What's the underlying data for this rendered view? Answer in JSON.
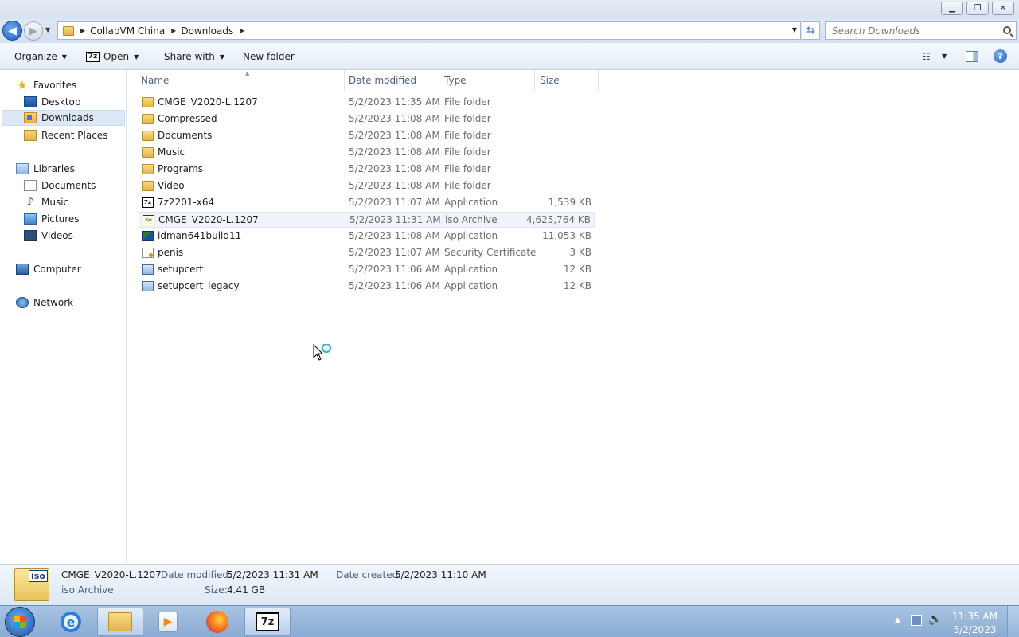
{
  "window": {
    "minimize_icon": "minimize-icon",
    "restore_icon": "restore-icon",
    "close_icon": "close-icon"
  },
  "address": {
    "crumbs": [
      "CollabVM China",
      "Downloads"
    ],
    "search_placeholder": "Search Downloads"
  },
  "toolbar": {
    "organize": "Organize",
    "open": "Open",
    "share_with": "Share with",
    "new_folder": "New folder"
  },
  "nav": {
    "favorites": {
      "label": "Favorites",
      "items": [
        "Desktop",
        "Downloads",
        "Recent Places"
      ]
    },
    "libraries": {
      "label": "Libraries",
      "items": [
        "Documents",
        "Music",
        "Pictures",
        "Videos"
      ]
    },
    "computer": "Computer",
    "network": "Network",
    "selected": "Downloads"
  },
  "columns": {
    "name": "Name",
    "date": "Date modified",
    "type": "Type",
    "size": "Size"
  },
  "files": [
    {
      "name": "CMGE_V2020-L.1207",
      "date": "5/2/2023 11:35 AM",
      "type": "File folder",
      "size": "",
      "icon": "folder-icon"
    },
    {
      "name": "Compressed",
      "date": "5/2/2023 11:08 AM",
      "type": "File folder",
      "size": "",
      "icon": "folder-icon"
    },
    {
      "name": "Documents",
      "date": "5/2/2023 11:08 AM",
      "type": "File folder",
      "size": "",
      "icon": "folder-icon"
    },
    {
      "name": "Music",
      "date": "5/2/2023 11:08 AM",
      "type": "File folder",
      "size": "",
      "icon": "folder-icon"
    },
    {
      "name": "Programs",
      "date": "5/2/2023 11:08 AM",
      "type": "File folder",
      "size": "",
      "icon": "folder-icon"
    },
    {
      "name": "Video",
      "date": "5/2/2023 11:08 AM",
      "type": "File folder",
      "size": "",
      "icon": "folder-icon"
    },
    {
      "name": "7z2201-x64",
      "date": "5/2/2023 11:07 AM",
      "type": "Application",
      "size": "1,539 KB",
      "icon": "7zip-icon"
    },
    {
      "name": "CMGE_V2020-L.1207",
      "date": "5/2/2023 11:31 AM",
      "type": "iso Archive",
      "size": "4,625,764 KB",
      "icon": "iso-icon"
    },
    {
      "name": "idman641build11",
      "date": "5/2/2023 11:08 AM",
      "type": "Application",
      "size": "11,053 KB",
      "icon": "idm-icon"
    },
    {
      "name": "penis",
      "date": "5/2/2023 11:07 AM",
      "type": "Security Certificate",
      "size": "3 KB",
      "icon": "certificate-icon"
    },
    {
      "name": "setupcert",
      "date": "5/2/2023 11:06 AM",
      "type": "Application",
      "size": "12 KB",
      "icon": "application-icon"
    },
    {
      "name": "setupcert_legacy",
      "date": "5/2/2023 11:06 AM",
      "type": "Application",
      "size": "12 KB",
      "icon": "application-icon"
    }
  ],
  "details": {
    "icon_label": "iso",
    "name": "CMGE_V2020-L.1207",
    "type": "iso Archive",
    "date_modified_label": "Date modified:",
    "date_modified": "5/2/2023 11:31 AM",
    "date_created_label": "Date created:",
    "date_created": "5/2/2023 11:10 AM",
    "size_label": "Size:",
    "size": "4.41 GB"
  },
  "taskbar": {
    "apps": [
      "internet-explorer-icon",
      "windows-explorer-icon",
      "media-player-icon",
      "firefox-icon",
      "7zip-icon"
    ],
    "seven_zip_label": "7z",
    "clock_time": "11:35 AM",
    "clock_date": "5/2/2023"
  },
  "colors": {
    "accent": "#1b5cc0",
    "selection": "#dce8f7",
    "taskbar": "#8aabd3"
  }
}
